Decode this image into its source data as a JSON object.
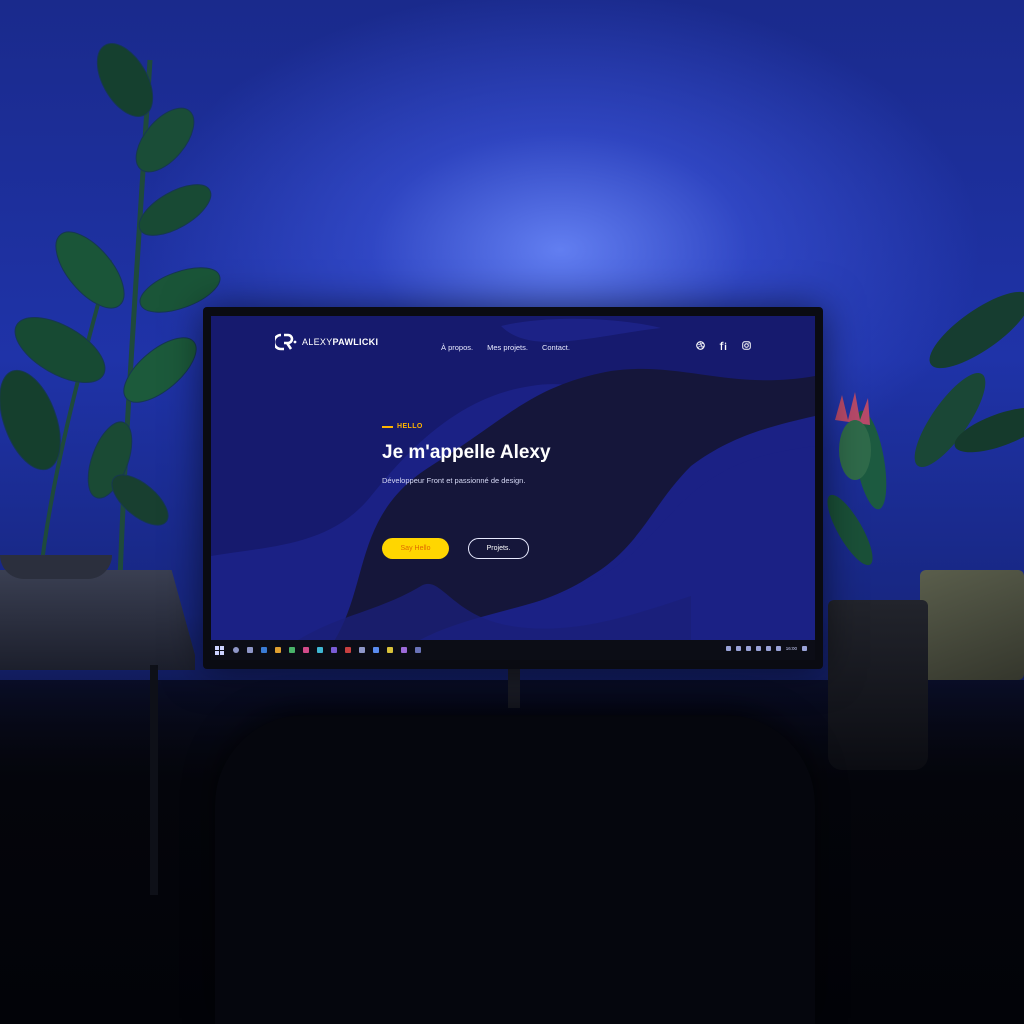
{
  "site": {
    "logo": {
      "first": "ALEXY",
      "last": "PAWLICKI"
    },
    "nav": [
      "À propos.",
      "Mes projets.",
      "Contact."
    ],
    "socials": [
      "dribbble-icon",
      "fiverr-icon",
      "instagram-icon"
    ]
  },
  "hero": {
    "eyebrow": "HELLO",
    "title": "Je m'appelle Alexy",
    "subtitle": "Développeur Front et passionné de design.",
    "primary_button": "Say Hello",
    "secondary_button": "Projets."
  },
  "taskbar": {
    "clock": "16:00"
  },
  "colors": {
    "accent": "#ffb400",
    "button_yellow": "#ffd600",
    "bg_dark": "#141533",
    "wave_blue": "#1b2185"
  }
}
